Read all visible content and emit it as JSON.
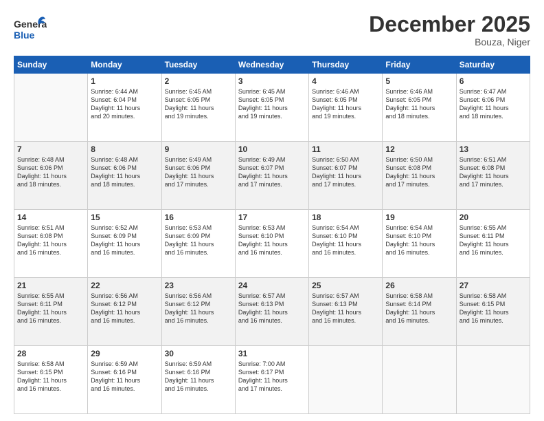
{
  "header": {
    "logo_line1": "General",
    "logo_line2": "Blue",
    "month": "December 2025",
    "location": "Bouza, Niger"
  },
  "days_of_week": [
    "Sunday",
    "Monday",
    "Tuesday",
    "Wednesday",
    "Thursday",
    "Friday",
    "Saturday"
  ],
  "weeks": [
    [
      {
        "day": "",
        "text": ""
      },
      {
        "day": "1",
        "text": "Sunrise: 6:44 AM\nSunset: 6:04 PM\nDaylight: 11 hours\nand 20 minutes."
      },
      {
        "day": "2",
        "text": "Sunrise: 6:45 AM\nSunset: 6:05 PM\nDaylight: 11 hours\nand 19 minutes."
      },
      {
        "day": "3",
        "text": "Sunrise: 6:45 AM\nSunset: 6:05 PM\nDaylight: 11 hours\nand 19 minutes."
      },
      {
        "day": "4",
        "text": "Sunrise: 6:46 AM\nSunset: 6:05 PM\nDaylight: 11 hours\nand 19 minutes."
      },
      {
        "day": "5",
        "text": "Sunrise: 6:46 AM\nSunset: 6:05 PM\nDaylight: 11 hours\nand 18 minutes."
      },
      {
        "day": "6",
        "text": "Sunrise: 6:47 AM\nSunset: 6:06 PM\nDaylight: 11 hours\nand 18 minutes."
      }
    ],
    [
      {
        "day": "7",
        "text": "Sunrise: 6:48 AM\nSunset: 6:06 PM\nDaylight: 11 hours\nand 18 minutes."
      },
      {
        "day": "8",
        "text": "Sunrise: 6:48 AM\nSunset: 6:06 PM\nDaylight: 11 hours\nand 18 minutes."
      },
      {
        "day": "9",
        "text": "Sunrise: 6:49 AM\nSunset: 6:06 PM\nDaylight: 11 hours\nand 17 minutes."
      },
      {
        "day": "10",
        "text": "Sunrise: 6:49 AM\nSunset: 6:07 PM\nDaylight: 11 hours\nand 17 minutes."
      },
      {
        "day": "11",
        "text": "Sunrise: 6:50 AM\nSunset: 6:07 PM\nDaylight: 11 hours\nand 17 minutes."
      },
      {
        "day": "12",
        "text": "Sunrise: 6:50 AM\nSunset: 6:08 PM\nDaylight: 11 hours\nand 17 minutes."
      },
      {
        "day": "13",
        "text": "Sunrise: 6:51 AM\nSunset: 6:08 PM\nDaylight: 11 hours\nand 17 minutes."
      }
    ],
    [
      {
        "day": "14",
        "text": "Sunrise: 6:51 AM\nSunset: 6:08 PM\nDaylight: 11 hours\nand 16 minutes."
      },
      {
        "day": "15",
        "text": "Sunrise: 6:52 AM\nSunset: 6:09 PM\nDaylight: 11 hours\nand 16 minutes."
      },
      {
        "day": "16",
        "text": "Sunrise: 6:53 AM\nSunset: 6:09 PM\nDaylight: 11 hours\nand 16 minutes."
      },
      {
        "day": "17",
        "text": "Sunrise: 6:53 AM\nSunset: 6:10 PM\nDaylight: 11 hours\nand 16 minutes."
      },
      {
        "day": "18",
        "text": "Sunrise: 6:54 AM\nSunset: 6:10 PM\nDaylight: 11 hours\nand 16 minutes."
      },
      {
        "day": "19",
        "text": "Sunrise: 6:54 AM\nSunset: 6:10 PM\nDaylight: 11 hours\nand 16 minutes."
      },
      {
        "day": "20",
        "text": "Sunrise: 6:55 AM\nSunset: 6:11 PM\nDaylight: 11 hours\nand 16 minutes."
      }
    ],
    [
      {
        "day": "21",
        "text": "Sunrise: 6:55 AM\nSunset: 6:11 PM\nDaylight: 11 hours\nand 16 minutes."
      },
      {
        "day": "22",
        "text": "Sunrise: 6:56 AM\nSunset: 6:12 PM\nDaylight: 11 hours\nand 16 minutes."
      },
      {
        "day": "23",
        "text": "Sunrise: 6:56 AM\nSunset: 6:12 PM\nDaylight: 11 hours\nand 16 minutes."
      },
      {
        "day": "24",
        "text": "Sunrise: 6:57 AM\nSunset: 6:13 PM\nDaylight: 11 hours\nand 16 minutes."
      },
      {
        "day": "25",
        "text": "Sunrise: 6:57 AM\nSunset: 6:13 PM\nDaylight: 11 hours\nand 16 minutes."
      },
      {
        "day": "26",
        "text": "Sunrise: 6:58 AM\nSunset: 6:14 PM\nDaylight: 11 hours\nand 16 minutes."
      },
      {
        "day": "27",
        "text": "Sunrise: 6:58 AM\nSunset: 6:15 PM\nDaylight: 11 hours\nand 16 minutes."
      }
    ],
    [
      {
        "day": "28",
        "text": "Sunrise: 6:58 AM\nSunset: 6:15 PM\nDaylight: 11 hours\nand 16 minutes."
      },
      {
        "day": "29",
        "text": "Sunrise: 6:59 AM\nSunset: 6:16 PM\nDaylight: 11 hours\nand 16 minutes."
      },
      {
        "day": "30",
        "text": "Sunrise: 6:59 AM\nSunset: 6:16 PM\nDaylight: 11 hours\nand 16 minutes."
      },
      {
        "day": "31",
        "text": "Sunrise: 7:00 AM\nSunset: 6:17 PM\nDaylight: 11 hours\nand 17 minutes."
      },
      {
        "day": "",
        "text": ""
      },
      {
        "day": "",
        "text": ""
      },
      {
        "day": "",
        "text": ""
      }
    ]
  ]
}
